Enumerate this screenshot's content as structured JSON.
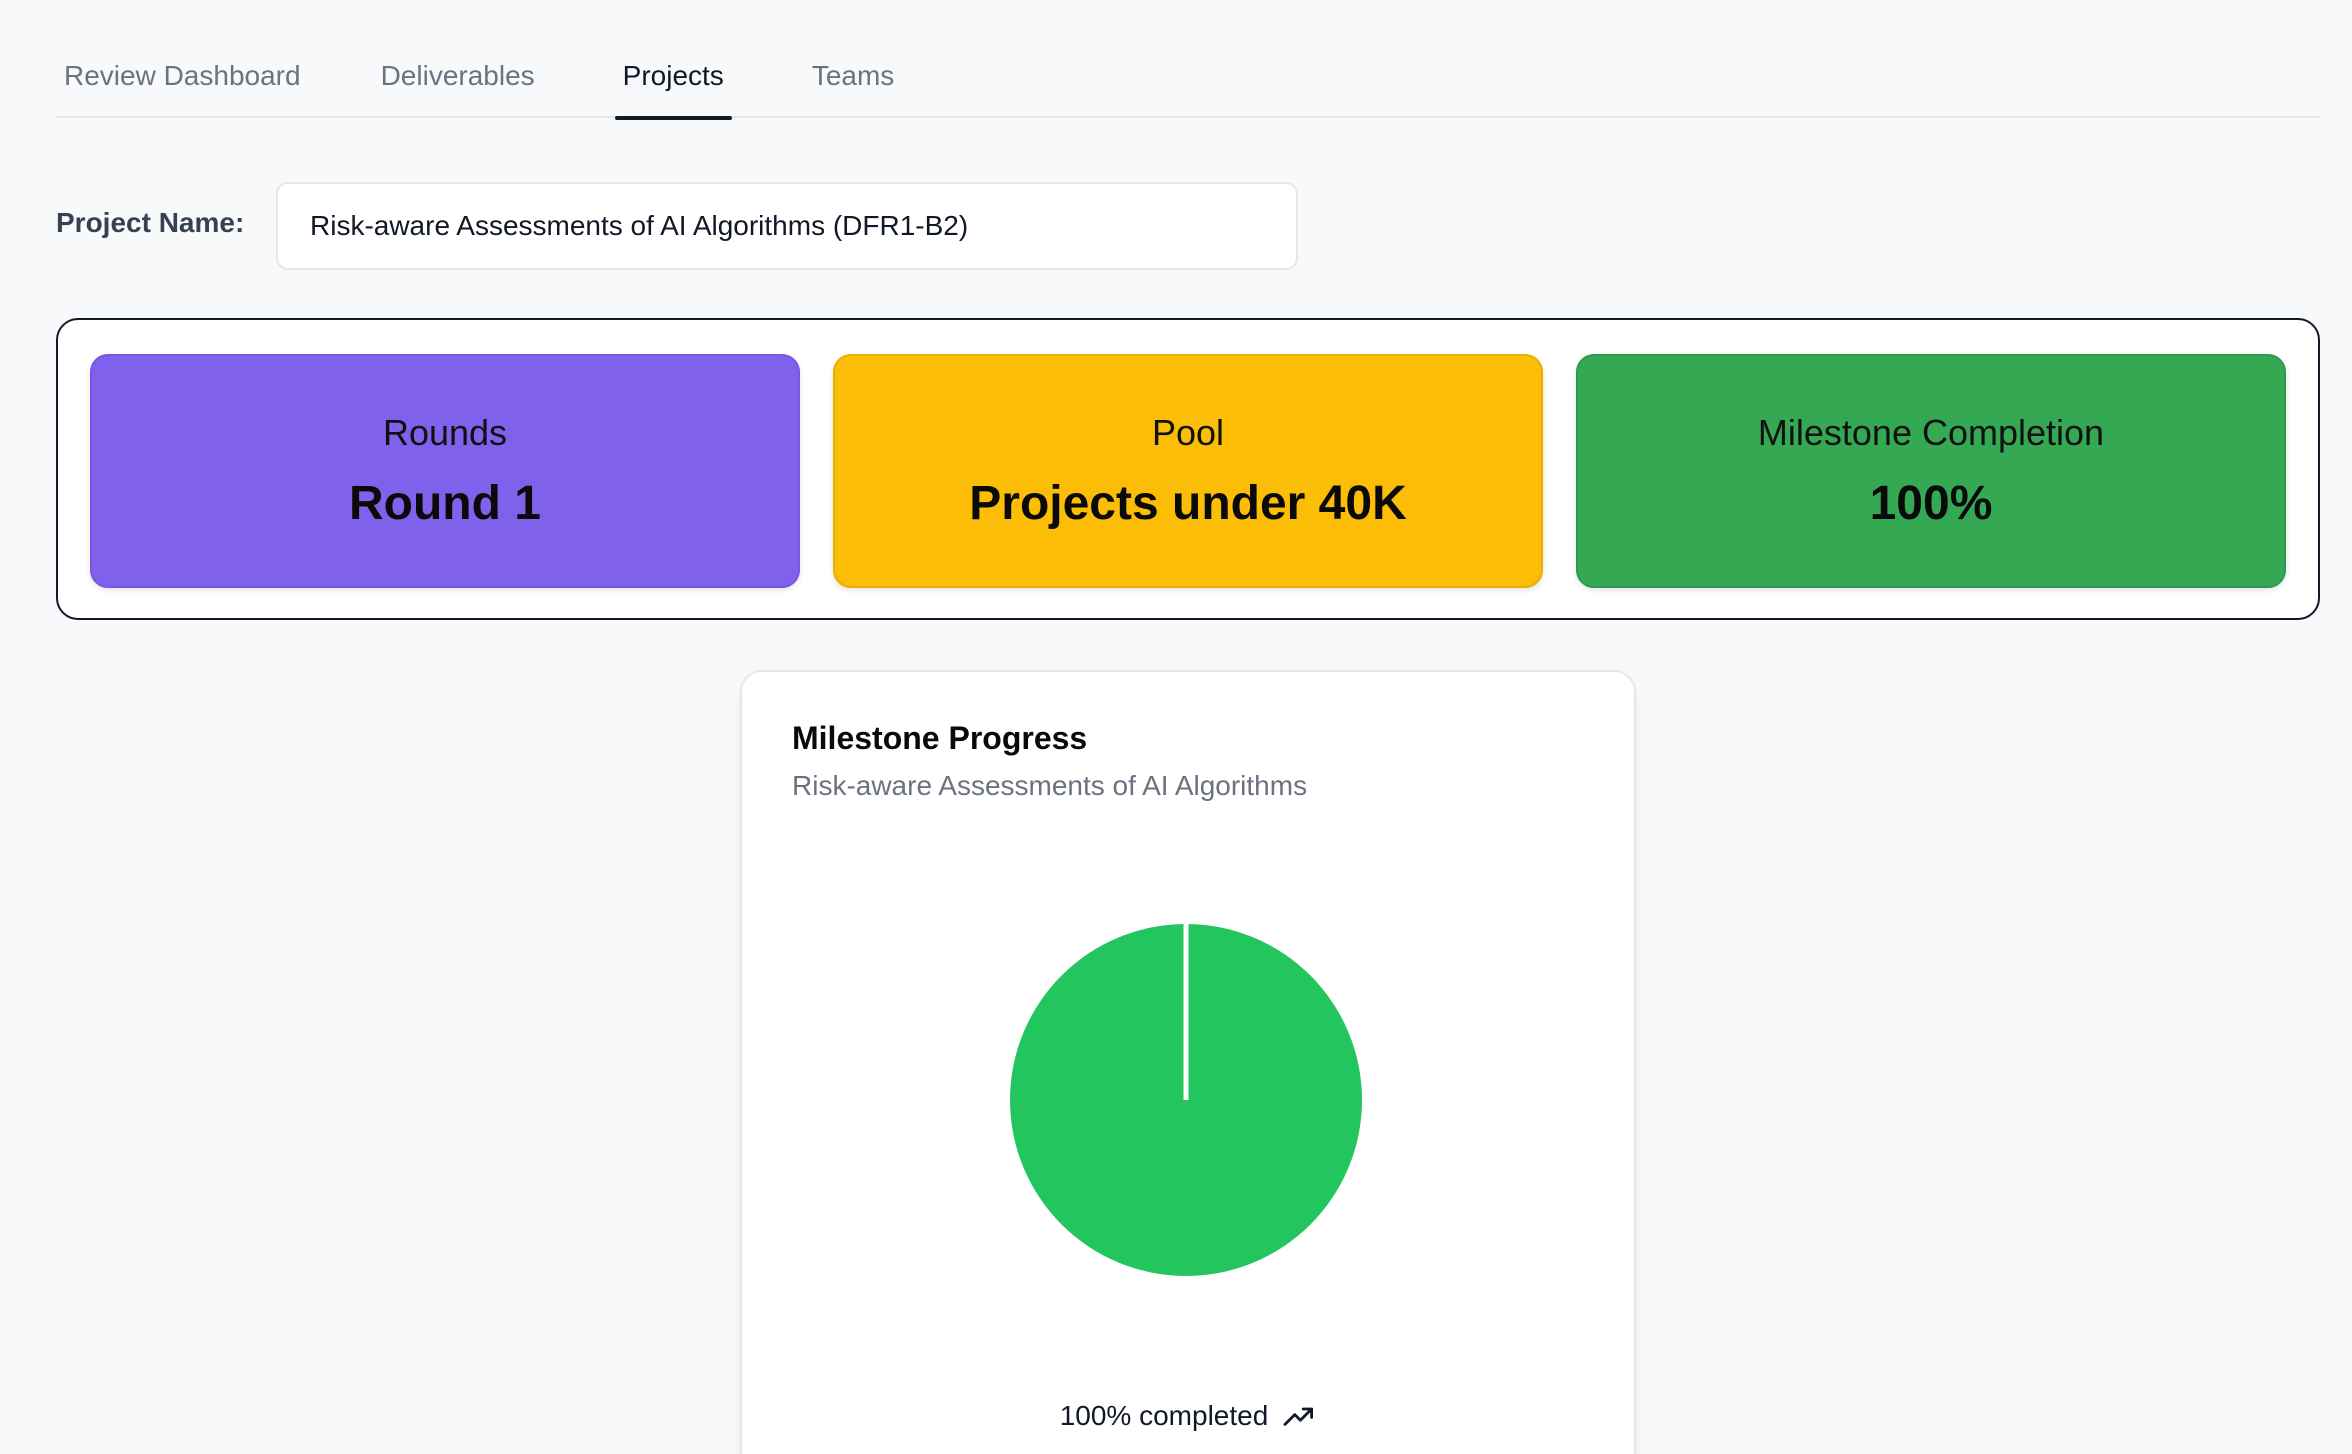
{
  "tabs": [
    {
      "label": "Review Dashboard"
    },
    {
      "label": "Deliverables"
    },
    {
      "label": "Projects"
    },
    {
      "label": "Teams"
    }
  ],
  "active_tab": "Projects",
  "project": {
    "label": "Project Name:",
    "value": "Risk-aware Assessments of AI Algorithms (DFR1-B2)"
  },
  "stats": {
    "rounds": {
      "label": "Rounds",
      "value": "Round 1",
      "color": "#8061ec"
    },
    "pool": {
      "label": "Pool",
      "value": "Projects under 40K",
      "color": "#fbbd05"
    },
    "milestone": {
      "label": "Milestone Completion",
      "value": "100%",
      "color": "#34a853"
    }
  },
  "chart": {
    "title": "Milestone Progress",
    "subtitle": "Risk-aware Assessments of AI Algorithms",
    "footer_text": "100% completed",
    "footer_icon": "trending-up-icon"
  },
  "chart_data": {
    "type": "pie",
    "title": "Milestone Progress",
    "subtitle": "Risk-aware Assessments of AI Algorithms",
    "slices": [
      {
        "value": 100,
        "color": "#22c55e"
      },
      {
        "value": 0,
        "color": "#e5e7eb"
      }
    ]
  }
}
